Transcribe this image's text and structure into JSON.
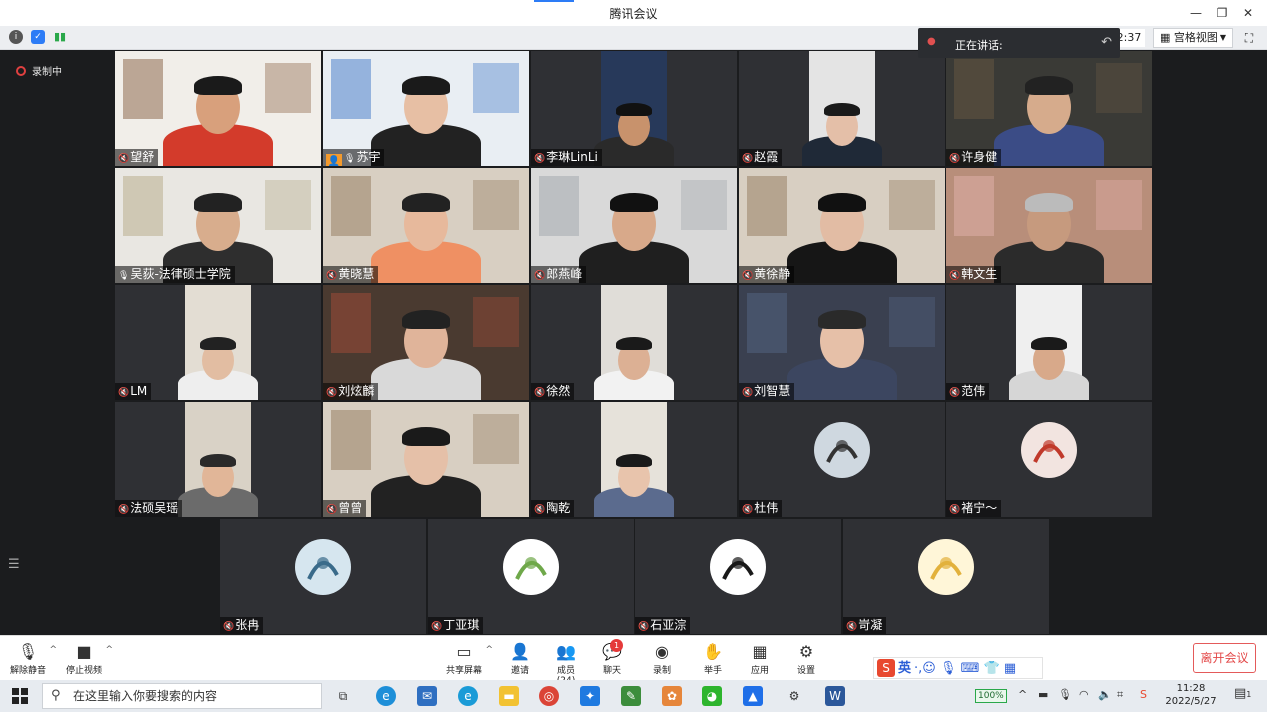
{
  "window": {
    "title": "腾讯会议"
  },
  "topbar": {
    "time_partial": "2:37",
    "view_label": "宫格视图",
    "speaking_label": "正在讲话:"
  },
  "recording": {
    "label": "录制中"
  },
  "participants": [
    {
      "name": "望舒",
      "mic": "off"
    },
    {
      "name": "苏宇",
      "mic": "on",
      "host": true
    },
    {
      "name": "李琳LinLi",
      "mic": "off"
    },
    {
      "name": "赵霞",
      "mic": "off"
    },
    {
      "name": "许身健",
      "mic": "off"
    },
    {
      "name": "吴荻-法律硕士学院",
      "mic": "on"
    },
    {
      "name": "黄晓慧",
      "mic": "off"
    },
    {
      "name": "郎燕峰",
      "mic": "off"
    },
    {
      "name": "黄徐静",
      "mic": "off"
    },
    {
      "name": "韩文生",
      "mic": "off"
    },
    {
      "name": "LM",
      "mic": "off"
    },
    {
      "name": "刘炫麟",
      "mic": "off"
    },
    {
      "name": "徐然",
      "mic": "off"
    },
    {
      "name": "刘智慧",
      "mic": "off"
    },
    {
      "name": "范伟",
      "mic": "off"
    },
    {
      "name": "法硕吴瑶",
      "mic": "off"
    },
    {
      "name": "曾曾",
      "mic": "off"
    },
    {
      "name": "陶乾",
      "mic": "off"
    },
    {
      "name": "杜伟",
      "mic": "off"
    },
    {
      "name": "褚宁～",
      "mic": "off"
    },
    {
      "name": "张冉",
      "mic": "off"
    },
    {
      "name": "丁亚琪",
      "mic": "off"
    },
    {
      "name": "石亚淙",
      "mic": "off"
    },
    {
      "name": "岢凝",
      "mic": "off"
    }
  ],
  "toolbar": {
    "unmute": "解除静音",
    "stop_video": "停止视频",
    "share_screen": "共享屏幕",
    "invite": "邀请",
    "members": "成员(24)",
    "chat": "聊天",
    "chat_badge": "1",
    "record": "录制",
    "raise_hand": "举手",
    "apps": "应用",
    "settings": "设置",
    "leave": "离开会议"
  },
  "ime": {
    "lang": "英"
  },
  "taskbar": {
    "search_placeholder": "在这里输入你要搜索的内容",
    "battery": "100%",
    "time": "11:28",
    "date": "2022/5/27",
    "notif_count": "1"
  },
  "colors": {
    "accent": "#2d7cf6",
    "leave": "#e34848",
    "host": "#f39a2d",
    "tile_bg": "#2f3034"
  }
}
